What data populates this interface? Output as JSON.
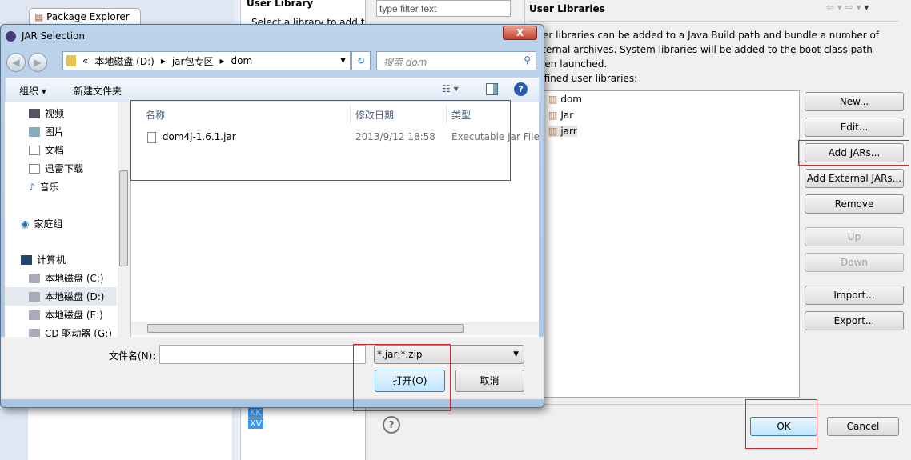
{
  "eclipse": {
    "package_explorer_tab": "Package Explorer",
    "wizard_title": "User Library",
    "wizard_desc": "Select a library to add to",
    "filter_placeholder": "type filter text",
    "highlighted_items": [
      "KK",
      "XV"
    ]
  },
  "prefs": {
    "title": "User Libraries",
    "description": "User libraries can be added to a Java Build path and bundle a number of external archives. System libraries will be added to the boot class path when launched.",
    "list_label": "Defined user libraries:",
    "libraries": [
      "dom",
      "Jar",
      "jarr"
    ],
    "buttons": {
      "new": "New...",
      "edit": "Edit...",
      "add_jars": "Add JARs...",
      "add_external": "Add External JARs...",
      "remove": "Remove",
      "up": "Up",
      "down": "Down",
      "import": "Import...",
      "export": "Export..."
    },
    "ok": "OK",
    "cancel": "Cancel"
  },
  "jar_dialog": {
    "title": "JAR Selection",
    "path": [
      "«",
      "本地磁盘 (D:)",
      "jar包专区",
      "dom"
    ],
    "search_placeholder": "搜索 dom",
    "toolbar": {
      "organize": "组织 ▾",
      "new_folder": "新建文件夹"
    },
    "nav": [
      "视频",
      "图片",
      "文档",
      "迅雷下载",
      "音乐",
      "家庭组",
      "计算机",
      "本地磁盘 (C:)",
      "本地磁盘 (D:)",
      "本地磁盘 (E:)",
      "CD 驱动器 (G:)"
    ],
    "columns": {
      "name": "名称",
      "date": "修改日期",
      "type": "类型"
    },
    "files": [
      {
        "name": "dom4j-1.6.1.jar",
        "date": "2013/9/12 18:58",
        "type": "Executable Jar File"
      }
    ],
    "filename_label": "文件名(N):",
    "filename_value": "",
    "filter_value": "*.jar;*.zip",
    "open": "打开(O)",
    "cancel": "取消",
    "close": "X"
  }
}
